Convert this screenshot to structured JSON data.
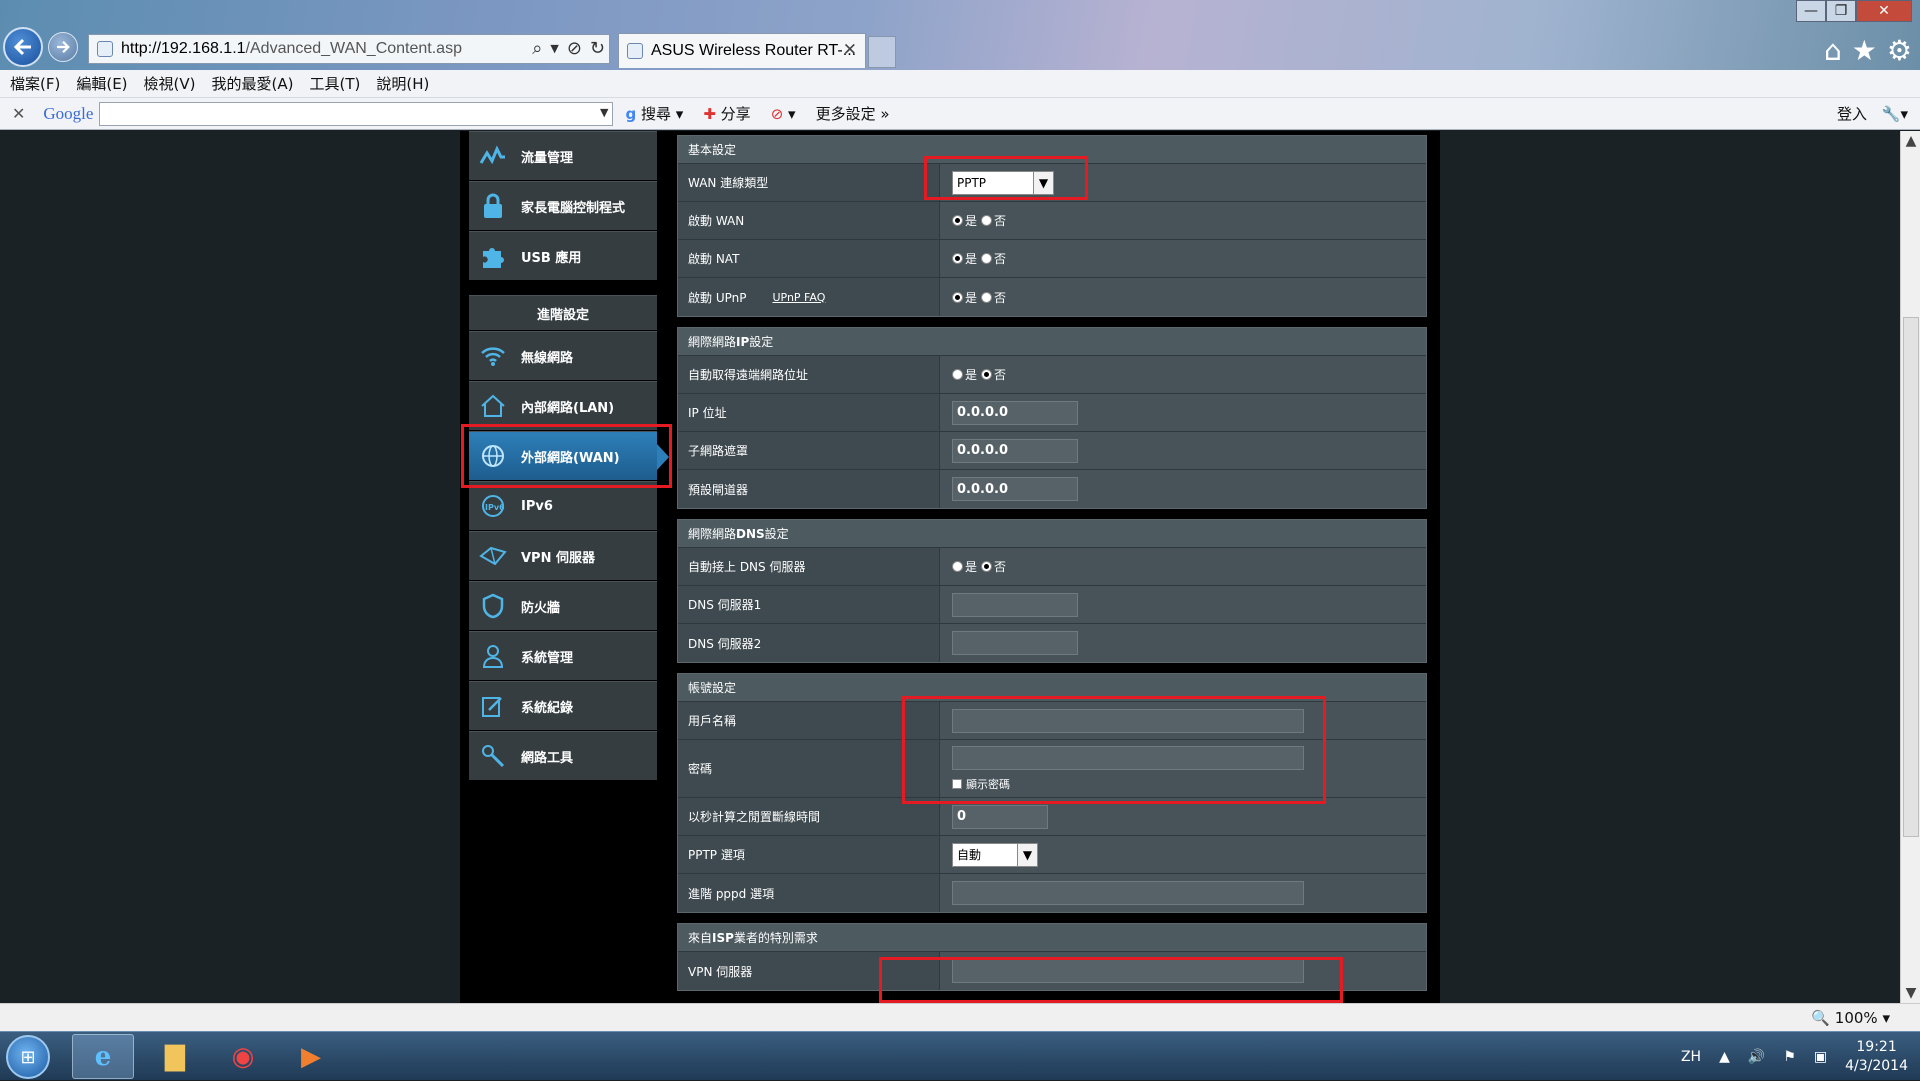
{
  "browser": {
    "url_host": "http://192.168.1.1",
    "url_path": "/Advanced_WAN_Content.asp",
    "tab_title": "ASUS Wireless Router RT-...",
    "menu": [
      "檔案(F)",
      "編輯(E)",
      "檢視(V)",
      "我的最愛(A)",
      "工具(T)",
      "說明(H)"
    ],
    "google_label": "Google",
    "search_label": "搜尋",
    "share_label": "分享",
    "more_settings_label": "更多設定",
    "login_label": "登入",
    "zoom": "100%"
  },
  "sidebar": {
    "top_items": [
      {
        "label": "流量管理",
        "icon": "traffic-icon"
      },
      {
        "label": "家長電腦控制程式",
        "icon": "lock-icon"
      },
      {
        "label": "USB 應用",
        "icon": "puzzle-icon"
      }
    ],
    "advanced_header": "進階設定",
    "items": [
      {
        "label": "無線網路",
        "icon": "wifi-icon"
      },
      {
        "label": "內部網路(LAN)",
        "icon": "home-icon"
      },
      {
        "label": "外部網路(WAN)",
        "icon": "globe-icon"
      },
      {
        "label": "IPv6",
        "icon": "ipv6-icon"
      },
      {
        "label": "VPN 伺服器",
        "icon": "vpn-icon"
      },
      {
        "label": "防火牆",
        "icon": "shield-icon"
      },
      {
        "label": "系統管理",
        "icon": "user-icon"
      },
      {
        "label": "系統紀錄",
        "icon": "log-icon"
      },
      {
        "label": "網路工具",
        "icon": "tools-icon"
      }
    ]
  },
  "basic": {
    "title": "基本設定",
    "wan_type_label": "WAN 連線類型",
    "wan_type_value": "PPTP",
    "enable_wan_label": "啟動 WAN",
    "enable_nat_label": "啟動 NAT",
    "enable_upnp_label": "啟動 UPnP",
    "upnp_faq": "UPnP  FAQ",
    "yes": "是",
    "no": "否"
  },
  "wan_ip": {
    "title_a": "網際網路 ",
    "title_b": "IP",
    "title_c": " 設定",
    "auto_ip_label": "自動取得遠端網路位址",
    "ip_label": "IP 位址",
    "ip_value": "0.0.0.0",
    "mask_label": "子網路遮罩",
    "mask_value": "0.0.0.0",
    "gateway_label": "預設閘道器",
    "gateway_value": "0.0.0.0"
  },
  "wan_dns": {
    "title_a": "網際網路 ",
    "title_b": "DNS",
    "title_c": " 設定",
    "auto_dns_label": "自動接上 DNS 伺服器",
    "dns1_label": "DNS 伺服器1",
    "dns1_value": "",
    "dns2_label": "DNS 伺服器2",
    "dns2_value": ""
  },
  "account": {
    "title": "帳號設定",
    "username_label": "用戶名稱",
    "username_value": "",
    "password_label": "密碼",
    "password_value": "",
    "show_password_label": "顯示密碼",
    "idle_label": "以秒計算之閒置斷線時間",
    "idle_value": "0",
    "pptp_option_label": "PPTP 選項",
    "pptp_option_value": "自動",
    "pppd_label": "進階 pppd 選項",
    "pppd_value": ""
  },
  "isp": {
    "title_a": "來自 ",
    "title_b": "ISP",
    "title_c": " 業者的特別需求",
    "vpn_server_label": "VPN 伺服器",
    "vpn_server_value": ""
  },
  "taskbar": {
    "lang": "ZH",
    "time": "19:21",
    "date": "4/3/2014"
  },
  "colors": {
    "highlight_red": "#e41b23",
    "active_nav": "#2d7fb9",
    "accent_icon": "#4fb5e6"
  }
}
